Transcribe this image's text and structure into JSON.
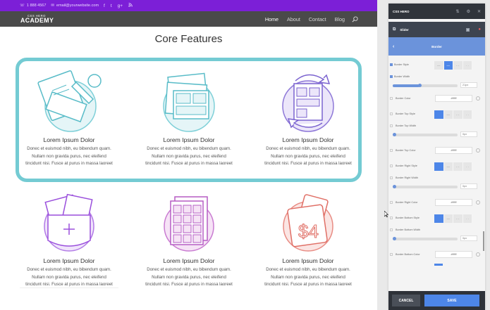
{
  "site": {
    "topbar": {
      "phone": "1 888 4567",
      "email": "email@yourwebsite.com",
      "social": [
        "f",
        "t",
        "g+",
        "rss"
      ]
    },
    "logo": {
      "small": "CSS HERO",
      "large": "ACADEMY"
    },
    "nav": [
      "Home",
      "About",
      "Contact",
      "Blog"
    ],
    "title": "Core Features",
    "features": [
      {
        "heading": "Lorem Ipsum Dolor",
        "text": [
          "Donec et euismod nibh, eu bibendum quam.",
          "Nullam non gravida purus, nec eleifend",
          "tincidunt nisi. Fusce at purus in massa laoreet"
        ],
        "icon": "tools-icon"
      },
      {
        "heading": "Lorem Ipsum Dolor",
        "text": [
          "Donec et euismod nibh, eu bibendum quam.",
          "Nullam non gravida purus, nec eleifend",
          "tincidunt nisi. Fusce at purus in massa laoreet"
        ],
        "icon": "layout-cards-icon"
      },
      {
        "heading": "Lorem Ipsum Dolor",
        "text": [
          "Donec et euismod nibh, eu bibendum quam.",
          "Nullam non gravida purus, nec eleifend",
          "tincidunt nisi. Fusce at purus in massa laoreet"
        ],
        "icon": "sync-layout-icon"
      },
      {
        "heading": "Lorem Ipsum Dolor",
        "text": [
          "Donec et euismod nibh, eu bibendum quam.",
          "Nullam non gravida purus, nec eleifend",
          "tincidunt nisi. Fusce at purus in massa laoreet"
        ],
        "icon": "envelope-icon"
      },
      {
        "heading": "Lorem Ipsum Dolor",
        "text": [
          "Donec et euismod nibh, eu bibendum quam.",
          "Nullam non gravida purus, nec eleifend",
          "tincidunt nisi. Fusce at purus in massa laoreet"
        ],
        "icon": "grid-icon"
      },
      {
        "heading": "Lorem Ipsum Dolor",
        "text": [
          "Donec et euismod nibh, eu bibendum quam.",
          "Nullam non gravida purus, nec eleifend",
          "tincidunt nisi. Fusce at purus in massa laoreet"
        ],
        "icon": "price-tag-icon"
      }
    ]
  },
  "panel": {
    "app_title": "CSS HERO",
    "element": "Slider",
    "section": "Border",
    "fields": {
      "border_style": "Border Style",
      "border_width": "Border Width",
      "border_width_value": "21px",
      "border_color": "Border Color",
      "border_color_value": "#ffffff",
      "top_style": "Border Top Style",
      "top_width": "Border Top Width",
      "top_width_value": "0px",
      "top_color": "Border Top Color",
      "top_color_value": "#ffffff",
      "right_style": "Border Right Style",
      "right_width": "Border Right Width",
      "right_width_value": "0px",
      "right_color": "Border Right Color",
      "right_color_value": "#ffffff",
      "bottom_style": "Border Bottom Style",
      "bottom_width": "Border Bottom Width",
      "bottom_width_value": "0px",
      "bottom_color": "Border Bottom Color",
      "bottom_color_value": "#ffffff"
    },
    "style_options": [
      "—",
      "—",
      "- -",
      "· ·"
    ],
    "cancel": "CANCEL",
    "save": "SAVE"
  },
  "colors": {
    "accent": "#7c1fd7",
    "highlight_border": "#74cbd3",
    "panel_blue": "#6b93db"
  }
}
